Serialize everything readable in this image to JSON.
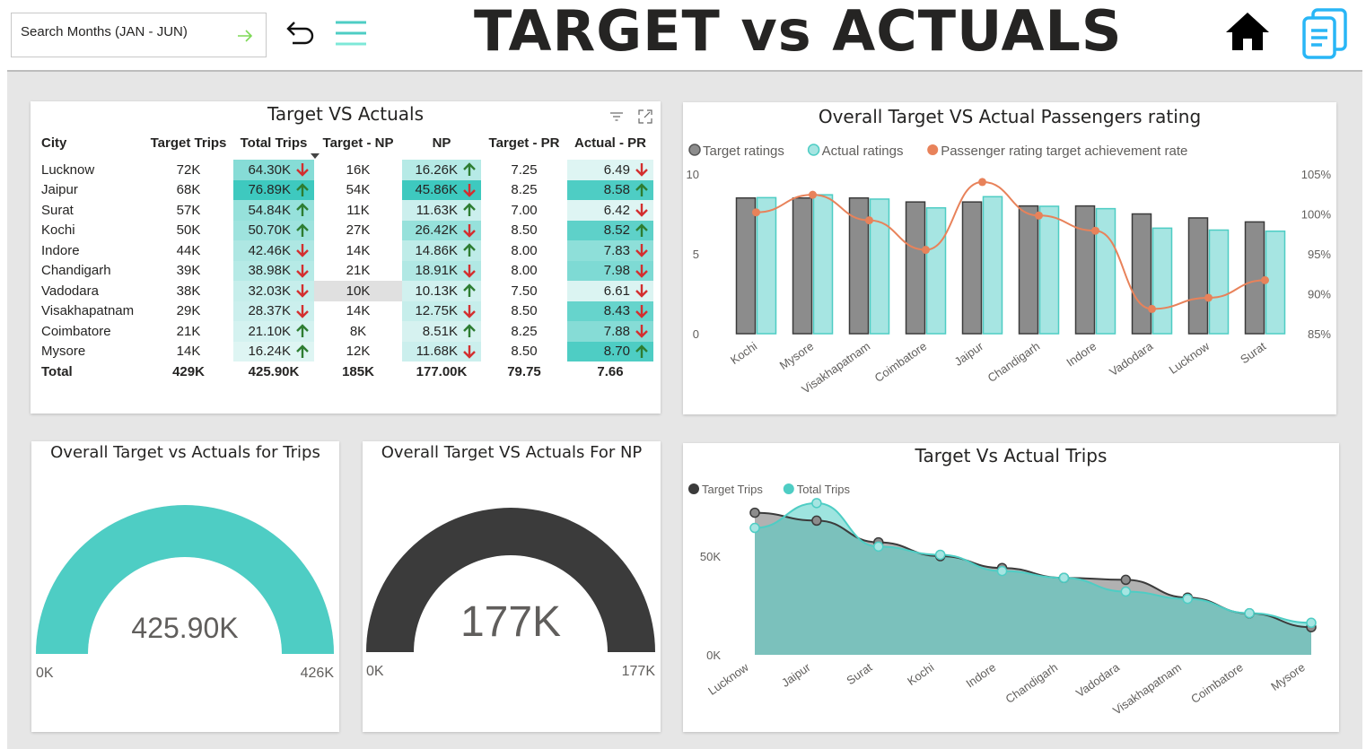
{
  "header": {
    "search_placeholder": "Search Months (JAN - JUN)",
    "title": "TARGET vs ACTUALS",
    "icons": [
      "arrow-right-icon",
      "undo-icon",
      "hamburger-menu-icon",
      "home-icon",
      "document-icon"
    ]
  },
  "colors": {
    "teal": "#4ecdc4",
    "gray": "#8c8c8c",
    "orange": "#e8825a",
    "dark": "#3b3b3b",
    "up": "#2e7d32",
    "down": "#d32f2f"
  },
  "table": {
    "title": "Target VS Actuals",
    "columns": [
      "City",
      "Target Trips",
      "Total Trips",
      "Target - NP",
      "NP",
      "Target - PR",
      "Actual - PR"
    ],
    "rows": [
      {
        "city": "Lucknow",
        "target_trips": "72K",
        "total_trips": "64.30K",
        "total_trips_dir": "down",
        "target_np": "16K",
        "np": "16.26K",
        "np_dir": "up",
        "target_pr": "7.25",
        "actual_pr": "6.49",
        "actual_pr_dir": "down",
        "tt_shade": 0.55,
        "np_shade": 0.25,
        "pr_shade": 0.1,
        "tnp_shade": 0
      },
      {
        "city": "Jaipur",
        "target_trips": "68K",
        "total_trips": "76.89K",
        "total_trips_dir": "up",
        "target_np": "54K",
        "np": "45.86K",
        "np_dir": "down",
        "target_pr": "8.25",
        "actual_pr": "8.58",
        "actual_pr_dir": "up",
        "tt_shade": 1.0,
        "np_shade": 1.0,
        "pr_shade": 1.0,
        "tnp_shade": 0
      },
      {
        "city": "Surat",
        "target_trips": "57K",
        "total_trips": "54.84K",
        "total_trips_dir": "up",
        "target_np": "11K",
        "np": "11.63K",
        "np_dir": "up",
        "target_pr": "7.00",
        "actual_pr": "6.42",
        "actual_pr_dir": "down",
        "tt_shade": 0.45,
        "np_shade": 0.12,
        "pr_shade": 0.1,
        "tnp_shade": 0
      },
      {
        "city": "Kochi",
        "target_trips": "50K",
        "total_trips": "50.70K",
        "total_trips_dir": "up",
        "target_np": "27K",
        "np": "26.42K",
        "np_dir": "down",
        "target_pr": "8.50",
        "actual_pr": "8.52",
        "actual_pr_dir": "up",
        "tt_shade": 0.4,
        "np_shade": 0.45,
        "pr_shade": 0.9,
        "tnp_shade": 0
      },
      {
        "city": "Indore",
        "target_trips": "44K",
        "total_trips": "42.46K",
        "total_trips_dir": "down",
        "target_np": "14K",
        "np": "14.86K",
        "np_dir": "up",
        "target_pr": "8.00",
        "actual_pr": "7.83",
        "actual_pr_dir": "down",
        "tt_shade": 0.3,
        "np_shade": 0.2,
        "pr_shade": 0.6,
        "tnp_shade": 0
      },
      {
        "city": "Chandigarh",
        "target_trips": "39K",
        "total_trips": "38.98K",
        "total_trips_dir": "down",
        "target_np": "21K",
        "np": "18.91K",
        "np_dir": "down",
        "target_pr": "8.00",
        "actual_pr": "7.98",
        "actual_pr_dir": "down",
        "tt_shade": 0.25,
        "np_shade": 0.28,
        "pr_shade": 0.7,
        "tnp_shade": 0
      },
      {
        "city": "Vadodara",
        "target_trips": "38K",
        "total_trips": "32.03K",
        "total_trips_dir": "down",
        "target_np": "10K",
        "np": "10.13K",
        "np_dir": "up",
        "target_pr": "7.50",
        "actual_pr": "6.61",
        "actual_pr_dir": "down",
        "tt_shade": 0.15,
        "np_shade": 0.08,
        "pr_shade": 0.12,
        "tnp_shade": 1
      },
      {
        "city": "Visakhapatnam",
        "target_trips": "29K",
        "total_trips": "28.37K",
        "total_trips_dir": "down",
        "target_np": "14K",
        "np": "12.75K",
        "np_dir": "down",
        "target_pr": "8.50",
        "actual_pr": "8.43",
        "actual_pr_dir": "down",
        "tt_shade": 0.12,
        "np_shade": 0.15,
        "pr_shade": 0.85,
        "tnp_shade": 0
      },
      {
        "city": "Coimbatore",
        "target_trips": "21K",
        "total_trips": "21.10K",
        "total_trips_dir": "up",
        "target_np": "8K",
        "np": "8.51K",
        "np_dir": "up",
        "target_pr": "8.25",
        "actual_pr": "7.88",
        "actual_pr_dir": "down",
        "tt_shade": 0.06,
        "np_shade": 0.05,
        "pr_shade": 0.65,
        "tnp_shade": 0
      },
      {
        "city": "Mysore",
        "target_trips": "14K",
        "total_trips": "16.24K",
        "total_trips_dir": "up",
        "target_np": "12K",
        "np": "11.68K",
        "np_dir": "down",
        "target_pr": "8.50",
        "actual_pr": "8.70",
        "actual_pr_dir": "up",
        "tt_shade": 0.0,
        "np_shade": 0.12,
        "pr_shade": 1.0,
        "tnp_shade": 0
      }
    ],
    "total": {
      "city": "Total",
      "target_trips": "429K",
      "total_trips": "425.90K",
      "target_np": "185K",
      "np": "177.00K",
      "target_pr": "79.75",
      "actual_pr": "7.66"
    }
  },
  "gauges": {
    "trips": {
      "title": "Overall Target vs Actuals for Trips",
      "value_label": "425.90K",
      "min_label": "0K",
      "max_label": "426K",
      "fraction": 1.0
    },
    "np": {
      "title": "Overall Target VS Actuals For NP",
      "value_label": "177K",
      "min_label": "0K",
      "max_label": "177K",
      "fraction": 1.0
    }
  },
  "chart_data": [
    {
      "type": "bar",
      "title": "Overall Target VS Actual Passengers rating",
      "categories": [
        "Kochi",
        "Mysore",
        "Visakhapatnam",
        "Coimbatore",
        "Jaipur",
        "Chandigarh",
        "Indore",
        "Vadodara",
        "Lucknow",
        "Surat"
      ],
      "series": [
        {
          "name": "Target ratings",
          "values": [
            8.5,
            8.5,
            8.5,
            8.25,
            8.25,
            8.0,
            8.0,
            7.5,
            7.25,
            7.0
          ],
          "color": "#8c8c8c"
        },
        {
          "name": "Actual ratings",
          "values": [
            8.52,
            8.7,
            8.43,
            7.88,
            8.58,
            7.98,
            7.83,
            6.61,
            6.49,
            6.42
          ],
          "color": "#a6e5e2"
        },
        {
          "name": "Passenger rating target achievement rate",
          "type": "line",
          "axis": "secondary",
          "values": [
            100.2,
            102.4,
            99.2,
            95.5,
            104.0,
            99.8,
            97.9,
            88.1,
            89.5,
            91.7
          ],
          "color": "#e8825a"
        }
      ],
      "ylim": [
        0,
        10
      ],
      "y_ticks": [
        "0",
        "5",
        "10"
      ],
      "y2lim": [
        85,
        105
      ],
      "y2_ticks": [
        "85%",
        "90%",
        "95%",
        "100%",
        "105%"
      ],
      "legend": "top-left"
    },
    {
      "type": "area",
      "title": "Target Vs Actual Trips",
      "categories": [
        "Lucknow",
        "Jaipur",
        "Surat",
        "Kochi",
        "Indore",
        "Chandigarh",
        "Vadodara",
        "Visakhapatnam",
        "Coimbatore",
        "Mysore"
      ],
      "series": [
        {
          "name": "Target Trips",
          "values": [
            72,
            68,
            57,
            50,
            44,
            39,
            38,
            29,
            21,
            14
          ],
          "color": "#3b3b3b"
        },
        {
          "name": "Total Trips",
          "values": [
            64.3,
            76.89,
            54.84,
            50.7,
            42.46,
            38.98,
            32.03,
            28.37,
            21.1,
            16.24
          ],
          "color": "#4ecdc4"
        }
      ],
      "ylim": [
        0,
        80
      ],
      "y_ticks": [
        "0K",
        "50K"
      ],
      "legend": "top-left"
    }
  ]
}
